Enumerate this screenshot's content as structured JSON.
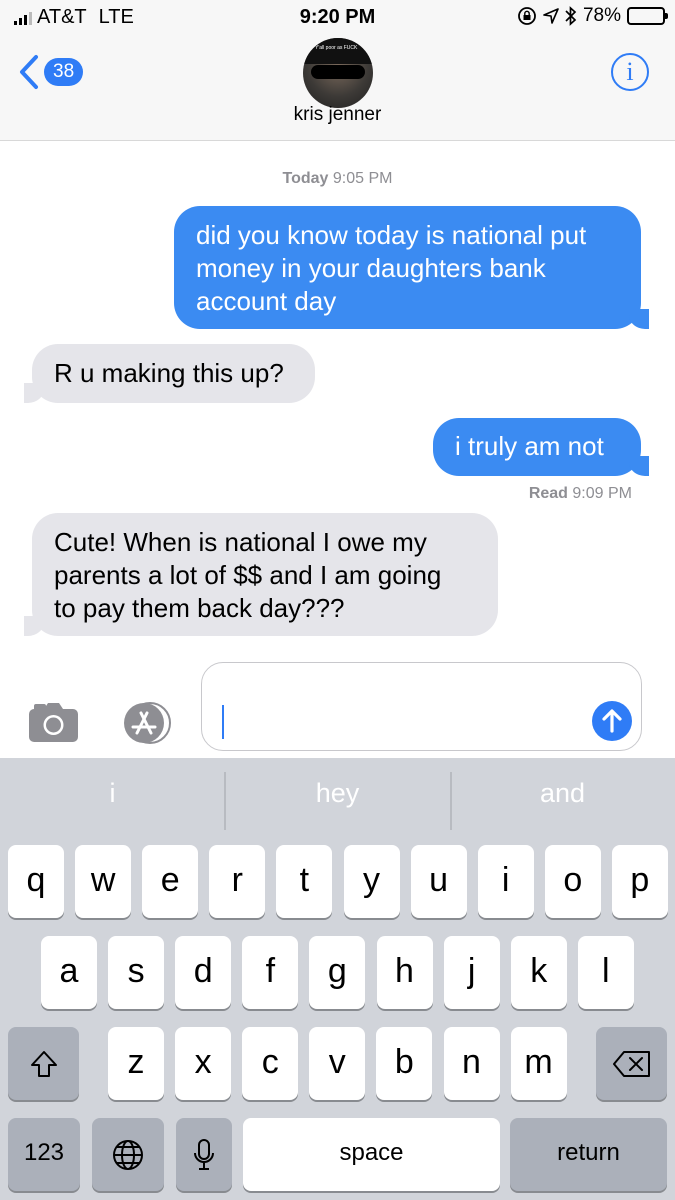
{
  "status_bar": {
    "carrier": "AT&T",
    "network": "LTE",
    "time": "9:20 PM",
    "battery": "78%",
    "battery_level": 0.78
  },
  "header": {
    "back_count": "38",
    "contact_name": "kris jenner",
    "avatar_caption": "Y'all poor as FUCK"
  },
  "conversation": {
    "timestamp_day": "Today",
    "timestamp_time": "9:05 PM",
    "read_label": "Read",
    "read_time": "9:09 PM",
    "messages": [
      {
        "direction": "sent",
        "lines": [
          "did you know today is national put",
          "money in your daughters bank",
          "account day"
        ]
      },
      {
        "direction": "received",
        "lines": [
          "R u making this up?"
        ]
      },
      {
        "direction": "sent",
        "lines": [
          "i truly am not"
        ]
      },
      {
        "direction": "received",
        "lines": [
          "Cute!  When is national I owe my",
          "parents a lot of $$ and I am going",
          "to pay them back day???"
        ]
      }
    ]
  },
  "input": {
    "value": ""
  },
  "keyboard": {
    "suggestions": [
      "i",
      "hey",
      "and"
    ],
    "row1": [
      "q",
      "w",
      "e",
      "r",
      "t",
      "y",
      "u",
      "i",
      "o",
      "p"
    ],
    "row2": [
      "a",
      "s",
      "d",
      "f",
      "g",
      "h",
      "j",
      "k",
      "l"
    ],
    "row3": [
      "z",
      "x",
      "c",
      "v",
      "b",
      "n",
      "m"
    ],
    "numbers_label": "123",
    "space_label": "space",
    "return_label": "return",
    "icons": {
      "shift": "shift-icon",
      "delete": "backspace-icon",
      "globe": "globe-icon",
      "mic": "microphone-icon"
    }
  },
  "colors": {
    "accent": "#2f7cf6",
    "sent_bubble": "#3b8bf2",
    "received_bubble": "#e5e5ea",
    "keyboard_bg": "#d1d4da"
  }
}
